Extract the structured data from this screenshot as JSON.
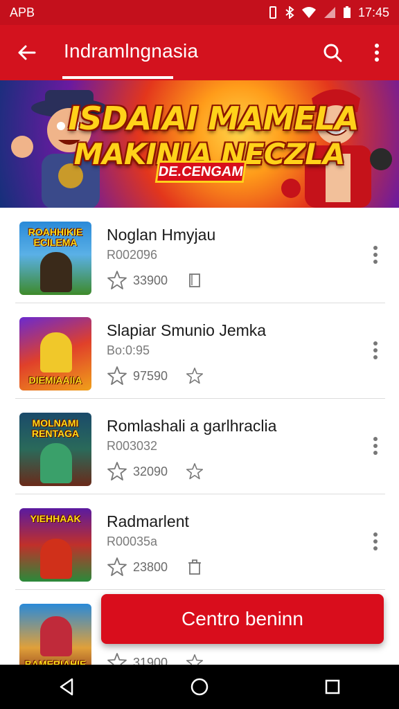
{
  "status_bar": {
    "left_text": "APB",
    "time": "17:45"
  },
  "app_bar": {
    "title": "Indramlngnasia"
  },
  "banner": {
    "line1": "ISDAIAI MAMELA",
    "line2": "MAKINIA NECZLA",
    "tag": "DE.CENGAM"
  },
  "items": [
    {
      "name": "Noglan Hmyjau",
      "code": "R0020̈96",
      "rating": "33900",
      "thumb_title": "ROAHHIKIE ECILEMA",
      "extra_icon": "bookmark-icon"
    },
    {
      "name": "Slapiar Smunio Jemka",
      "code": "Bo:0:95",
      "rating": "97590",
      "thumb_title": "DIEMIAAIIA",
      "extra_icon": "star-icon"
    },
    {
      "name": "Romlashali a garlhraclia",
      "code": "R003032",
      "rating": "32090",
      "thumb_title": "MOLNAMI RENTAGA",
      "extra_icon": "star-icon"
    },
    {
      "name": "Radmarlent",
      "code": "R00035a",
      "rating": "23800",
      "thumb_title": "YIEHHAAK",
      "extra_icon": "trash-icon"
    },
    {
      "name": "",
      "code": "",
      "rating": "31900",
      "thumb_title": "BAMERIAHIE",
      "extra_icon": "star-icon"
    }
  ],
  "cta": {
    "label": "Centro beninn"
  },
  "colors": {
    "primary": "#d3121e",
    "statusbar": "#c4101c"
  }
}
